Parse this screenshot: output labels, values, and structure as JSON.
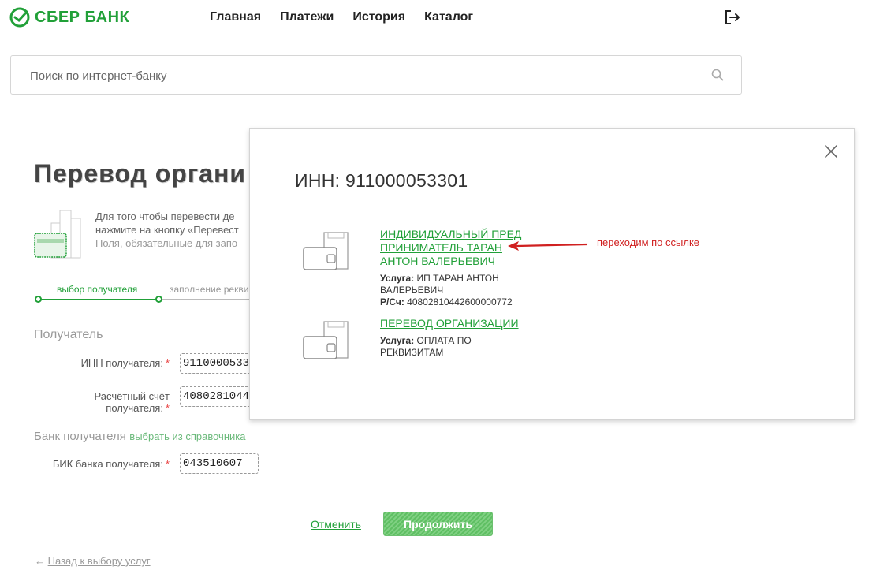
{
  "header": {
    "logo_text": "СБЕР БАНК",
    "nav": [
      "Главная",
      "Платежи",
      "История",
      "Каталог"
    ]
  },
  "search": {
    "placeholder": "Поиск по интернет-банку"
  },
  "page": {
    "title": "Перевод органи",
    "intro_line1": "Для того чтобы перевести де",
    "intro_line2": "нажмите на кнопку «Перевест",
    "intro_line3": "Поля, обязательные для запо",
    "steps": [
      "выбор получателя",
      "заполнение рекви"
    ],
    "recipient_section": "Получатель",
    "inn_label": "ИНН получателя:",
    "inn_value": "9110000533",
    "account_label_1": "Расчётный счёт",
    "account_label_2": "получателя:",
    "account_value": "4080281044",
    "bank_section": "Банк получателя",
    "bank_link": "выбрать из справочника",
    "bik_label": "БИК банка получателя:",
    "bik_value": "043510607",
    "required_mark": "*",
    "cancel": "Отменить",
    "continue": "Продолжить",
    "back_arrow": "←",
    "back": "Назад к выбору услуг"
  },
  "modal": {
    "title": "ИНН: 911000053301",
    "results": [
      {
        "link_lines": [
          "ИНДИВИДУАЛЬНЫЙ ПРЕД",
          "ПРИНИМАТЕЛЬ ТАРАН",
          "АНТОН ВАЛЕРЬЕВИЧ"
        ],
        "service_label": "Услуга:",
        "service_value_1": "ИП ТАРАН АНТОН",
        "service_value_2": "ВАЛЕРЬЕВИЧ",
        "account_label": "Р/Сч:",
        "account_value": "40802810442600000772"
      },
      {
        "link_lines": [
          "ПЕРЕВОД ОРГАНИЗАЦИИ"
        ],
        "service_label": "Услуга:",
        "service_value_1": "ОПЛАТА ПО",
        "service_value_2": "РЕКВИЗИТАМ"
      }
    ]
  },
  "annotation": {
    "text": "переходим по ссылке",
    "color": "#d02020"
  },
  "colors": {
    "brand_green": "#21a038",
    "link_green": "#21a038",
    "annotation_red": "#d02020"
  }
}
